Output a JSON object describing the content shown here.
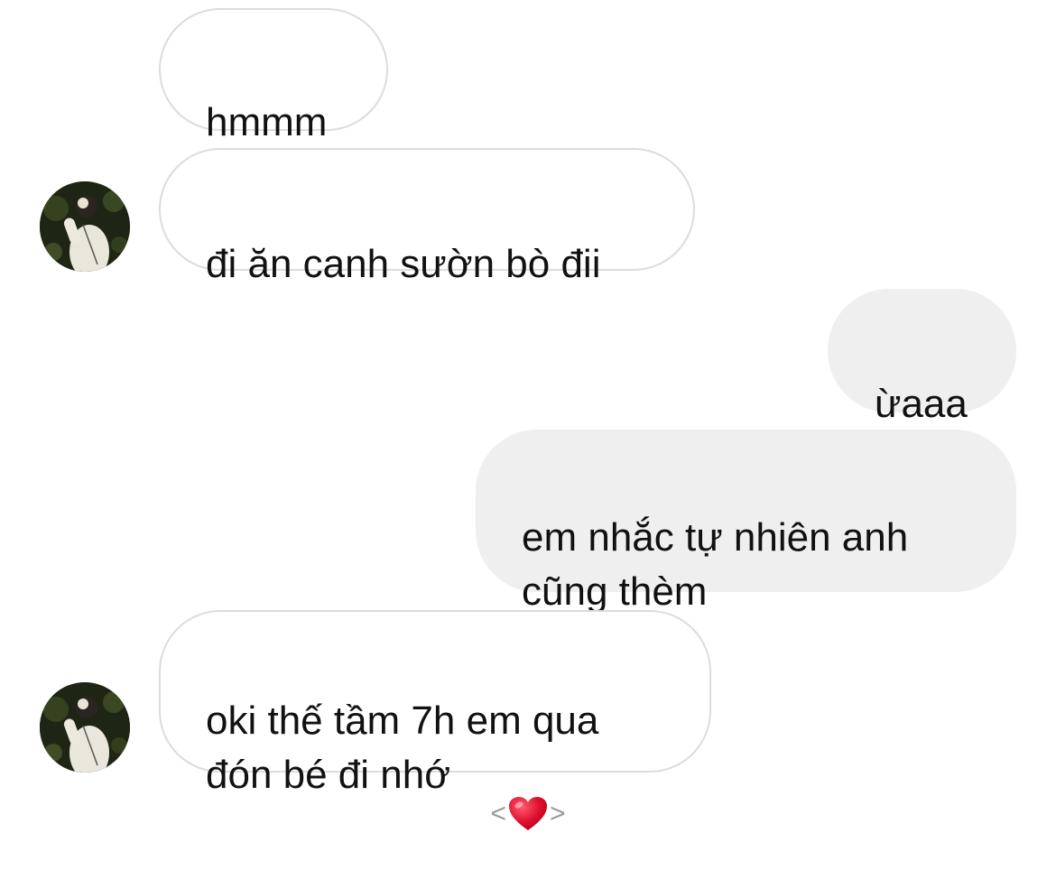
{
  "conversation": {
    "messages": [
      {
        "sender": "other",
        "text": "hmmm",
        "show_avatar": false
      },
      {
        "sender": "other",
        "text": "đi ăn canh sườn bò đii",
        "show_avatar": true
      },
      {
        "sender": "me",
        "text": "ừaaa"
      },
      {
        "sender": "me",
        "text": "em nhắc tự nhiên anh\ncũng thèm"
      },
      {
        "sender": "other",
        "text": "oki thế tầm 7h em qua\nđón bé đi nhớ",
        "show_avatar": true
      }
    ],
    "footer": {
      "left": "<",
      "icon": "heart-icon",
      "right": ">"
    }
  },
  "colors": {
    "sent_bubble": "#efefef",
    "received_border": "#dcdcdc",
    "heart": "#e0102f"
  }
}
